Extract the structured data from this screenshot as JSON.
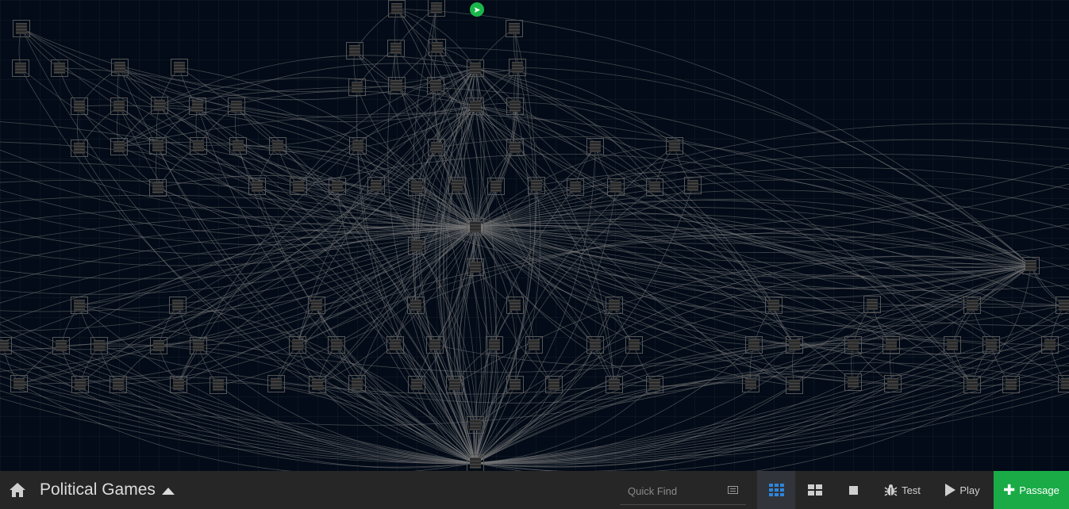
{
  "story": {
    "title": "Political Games"
  },
  "toolbar": {
    "quick_find_placeholder": "Quick Find",
    "test_label": "Test",
    "play_label": "Play",
    "passage_label": "Passage",
    "active_zoom": "grid-9"
  },
  "colors": {
    "background": "#020b17",
    "toolbar": "#262626",
    "passage_button": "#1aab47",
    "start_badge": "#1ab64a",
    "active_zoom_icon": "#2e86de",
    "link_line": "#7a7a7a"
  },
  "icons": {
    "home": "home-icon",
    "caret": "caret-up-icon",
    "quick_find": "highlight-icon",
    "zoom_large": "grid-9-icon",
    "zoom_medium": "grid-4-icon",
    "zoom_small": "square-icon",
    "test": "bug-icon",
    "play": "play-icon",
    "add": "plus-icon",
    "start": "rocket-icon"
  },
  "map": {
    "passage_count": 141,
    "start_passage_index": 0
  }
}
